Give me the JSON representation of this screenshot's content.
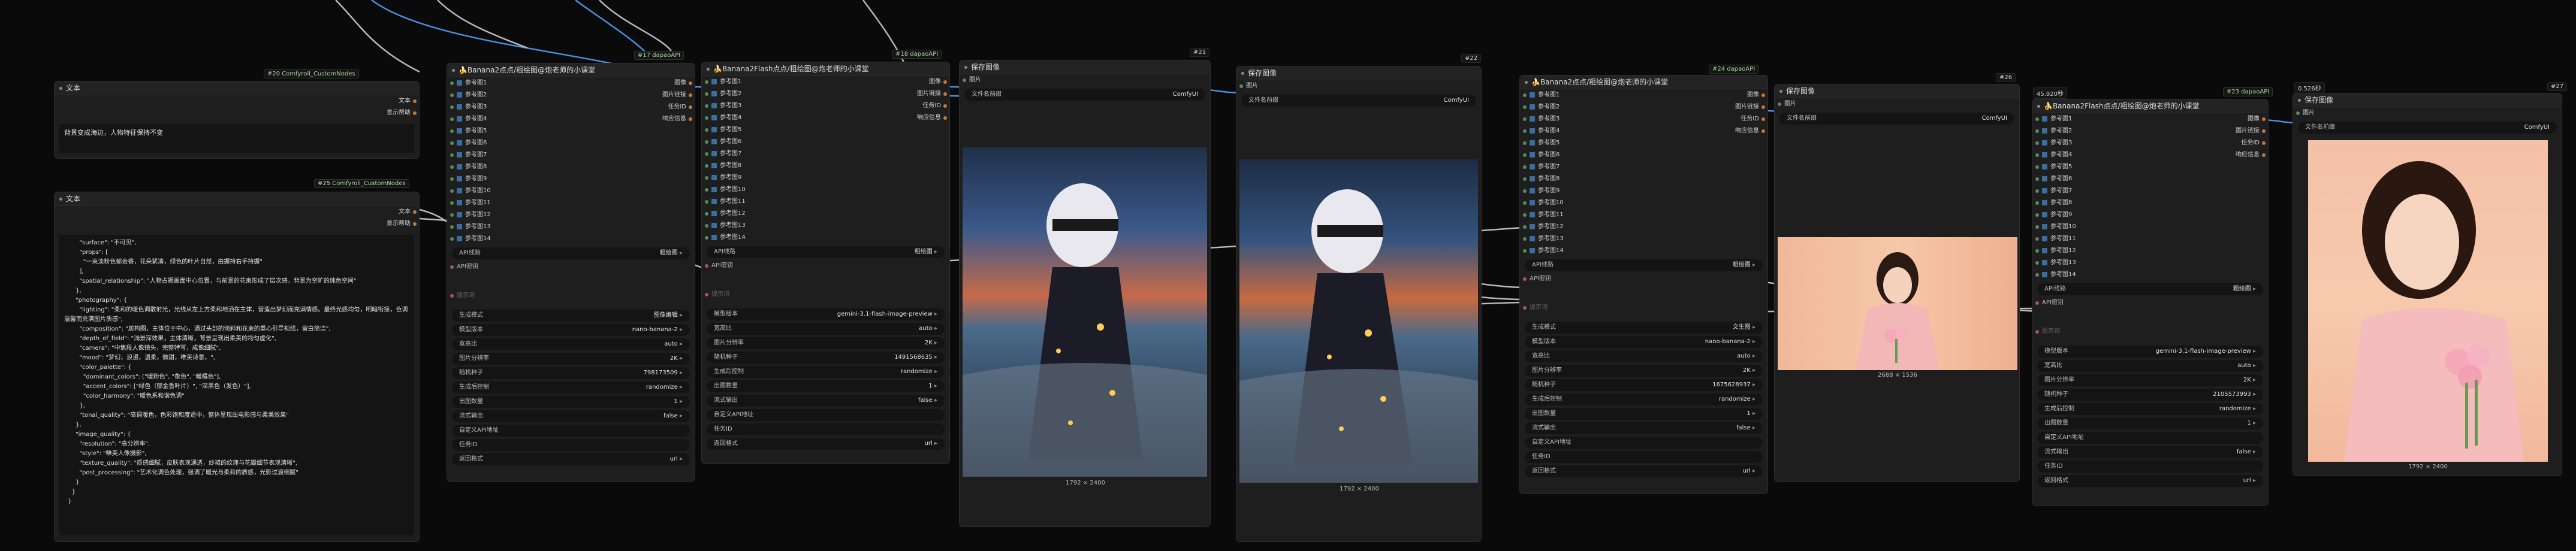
{
  "badges": {
    "b20": "#20 Comfyroll_CustomNodes",
    "b25": "#25 Comfyroll_CustomNodes",
    "b17": "#17 dapaoAPI",
    "b18": "#18 dapaoAPI",
    "b21": "#21",
    "b22": "#22",
    "b24": "#24 dapaoAPI",
    "b26": "#26",
    "b23": "#23 dapaoAPI",
    "b27": "#27",
    "t45": "45.920秒",
    "t05": "0.526秒"
  },
  "text_node_small": {
    "title": "文本",
    "out_text": "文本",
    "out_help": "显示帮助",
    "content": "背景变成海边，人物特征保持不变"
  },
  "text_node_large": {
    "title": "文本",
    "out_text": "文本",
    "out_help": "显示帮助",
    "content": "        \"surface\": \"不可见\",\n        \"props\": [\n          \"一束淡粉色郁金香，花朵紧凑，绿色的叶片自然，由握持右手持握\"\n        ],\n        \"spatial_relationship\": \"人物占据画面中心位置，与前景的花束形成了层次感，背景为空旷的纯色空间\"\n      },\n      \"photography\": {\n        \"lighting\": \"柔和的暖色调散射光，光线从左上方柔和地洒在主体，营造出梦幻而充满情感。最终光感均匀，明暗衔接，色调温馨而充满图片质感\",\n        \"composition\": \"居构图，主体位于中心，通过头部的倾斜和花束的重心引导视线，留白简洁\",\n        \"depth_of_field\": \"浅景深效果，主体清晰，背景呈现出柔美的均匀虚化\",\n        \"camera\": \"中焦段人像镜头，完整特写，成像细腻\",\n        \"mood\": \"梦幻，浪漫，温柔，微甜，唯美诗意，\",\n        \"color_palette\": {\n          \"dominant_colors\": [\"暖粉色\", \"象色\", \"暖橘色\"],\n          \"accent_colors\": [\"绿色（郁金香叶片）\", \"深黑色（发色）\"],\n          \"color_harmony\": \"暖色系和谐色调\"\n        },\n        \"tonal_quality\": \"高调暖色，色彩饱和度适中，整体呈现出电影感与柔美效果\"\n      },\n      \"image_quality\": {\n        \"resolution\": \"高分辨率\",\n        \"style\": \"唯美人像摄影\",\n        \"texture_quality\": \"质感细腻，皮肤表现通透，纱裙的纹理与花瓣细节表现清晰\",\n        \"post_processing\": \"艺术化调色处理，强调了暖光与柔和的质感，光影过渡细腻\"\n      }\n    }\n  }"
  },
  "inputs": [
    "参考图1",
    "参考图2",
    "参考图3",
    "参考图4",
    "参考图5",
    "参考图6",
    "参考图7",
    "参考图8",
    "参考图9",
    "参考图10",
    "参考图11",
    "参考图12",
    "参考图13",
    "参考图14"
  ],
  "node17": {
    "title": "🍌Banana2点点/粗绘图@炮老师的小课堂",
    "outputs": [
      "图像",
      "图片链接",
      "任务ID",
      "响应信息"
    ],
    "api_key": "API线路",
    "api_val": "粗绘图",
    "api_secret": "API密钥",
    "prompt_in": "提示词",
    "widgets": [
      {
        "l": "生成模式",
        "v": "图像编辑"
      },
      {
        "l": "模型版本",
        "v": "nano-banana-2"
      },
      {
        "l": "宽高比",
        "v": "auto"
      },
      {
        "l": "图片分辨率",
        "v": "2K"
      },
      {
        "l": "随机种子",
        "v": "798173509"
      },
      {
        "l": "生成后控制",
        "v": "randomize"
      },
      {
        "l": "出图数量",
        "v": "1"
      },
      {
        "l": "流式输出",
        "v": "false"
      },
      {
        "l": "自定义API地址",
        "v": ""
      },
      {
        "l": "任务ID",
        "v": ""
      },
      {
        "l": "返回格式",
        "v": "url"
      }
    ]
  },
  "node18": {
    "title": "🍌Banana2Flash点点/粗绘图@炮老师的小课堂",
    "outputs": [
      "图像",
      "图片链接",
      "任务ID",
      "响应信息"
    ],
    "api_key": "API线路",
    "api_val": "粗绘图",
    "api_secret": "API密钥",
    "prompt_in": "提示词",
    "widgets": [
      {
        "l": "模型版本",
        "v": "gemini-3.1-flash-image-preview"
      },
      {
        "l": "宽高比",
        "v": "auto"
      },
      {
        "l": "图片分辨率",
        "v": "2K"
      },
      {
        "l": "随机种子",
        "v": "1491568635"
      },
      {
        "l": "生成后控制",
        "v": "randomize"
      },
      {
        "l": "出图数量",
        "v": "1"
      },
      {
        "l": "流式输出",
        "v": "false"
      },
      {
        "l": "自定义API地址",
        "v": ""
      },
      {
        "l": "任务ID",
        "v": ""
      },
      {
        "l": "返回格式",
        "v": "url"
      }
    ]
  },
  "save21": {
    "title": "保存图像",
    "in": "图片",
    "prefix_label": "文件名前缀",
    "prefix_val": "ComfyUI",
    "dims": "1792 × 2400"
  },
  "save22": {
    "title": "保存图像",
    "in": "图片",
    "prefix_label": "文件名前缀",
    "prefix_val": "ComfyUI",
    "dims": "1792 × 2400"
  },
  "node24": {
    "title": "🍌Banana2点点/粗绘图@炮老师的小课堂",
    "outputs": [
      "图像",
      "图片链接",
      "任务ID",
      "响应信息"
    ],
    "api_key": "API线路",
    "api_val": "粗绘图",
    "api_secret": "API密钥",
    "prompt_in": "提示词",
    "widgets": [
      {
        "l": "生成模式",
        "v": "文生图"
      },
      {
        "l": "模型版本",
        "v": "nano-banana-2"
      },
      {
        "l": "宽高比",
        "v": "auto"
      },
      {
        "l": "图片分辨率",
        "v": "2K"
      },
      {
        "l": "随机种子",
        "v": "1675628937"
      },
      {
        "l": "生成后控制",
        "v": "randomize"
      },
      {
        "l": "出图数量",
        "v": "1"
      },
      {
        "l": "流式输出",
        "v": "false"
      },
      {
        "l": "自定义API地址",
        "v": ""
      },
      {
        "l": "任务ID",
        "v": ""
      },
      {
        "l": "返回格式",
        "v": "url"
      }
    ]
  },
  "save26": {
    "title": "保存图像",
    "in": "图片",
    "prefix_label": "文件名前缀",
    "prefix_val": "ComfyUI",
    "dims": "2688 × 1536"
  },
  "node23": {
    "title": "🍌Banana2Flash点点/粗绘图@炮老师的小课堂",
    "outputs": [
      "图像",
      "图片链接",
      "任务ID",
      "响应信息"
    ],
    "api_key": "API线路",
    "api_val": "粗绘图",
    "api_secret": "API密钥",
    "prompt_in": "提示词",
    "widgets": [
      {
        "l": "模型版本",
        "v": "gemini-3.1-flash-image-preview"
      },
      {
        "l": "宽高比",
        "v": "auto"
      },
      {
        "l": "图片分辨率",
        "v": "2K"
      },
      {
        "l": "随机种子",
        "v": "2105573993"
      },
      {
        "l": "生成后控制",
        "v": "randomize"
      },
      {
        "l": "出图数量",
        "v": "1"
      },
      {
        "l": "流式输出",
        "v": "false"
      },
      {
        "l": "自定义API地址",
        "v": ""
      },
      {
        "l": "任务ID",
        "v": ""
      },
      {
        "l": "返回格式",
        "v": "url"
      }
    ]
  },
  "save27": {
    "title": "保存图像",
    "in": "图片",
    "prefix_label": "文件名前缀",
    "prefix_val": "ComfyUI",
    "dims": "1792 × 2400"
  },
  "colors": {
    "wire_blue": "#4a8fe0",
    "wire_grey": "#b8b8b8",
    "accent_green": "#a8d8a0",
    "node_bg": "#1e1e1e"
  }
}
